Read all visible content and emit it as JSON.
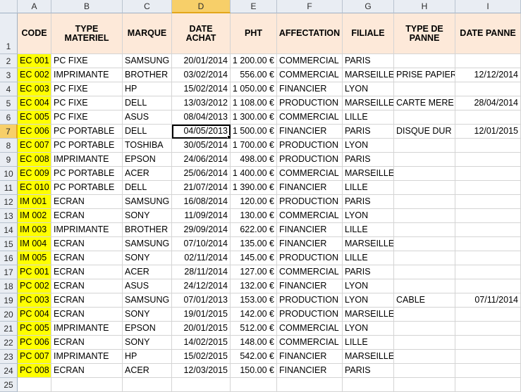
{
  "columns": [
    "A",
    "B",
    "C",
    "D",
    "E",
    "F",
    "G",
    "H",
    "I"
  ],
  "headers": [
    "CODE",
    "TYPE MATERIEL",
    "MARQUE",
    "DATE ACHAT",
    "PHT",
    "AFFECTATION",
    "FILIALE",
    "TYPE DE PANNE",
    "DATE PANNE"
  ],
  "row_numbers": [
    "1",
    "2",
    "3",
    "4",
    "5",
    "6",
    "7",
    "8",
    "9",
    "10",
    "11",
    "12",
    "13",
    "14",
    "15",
    "16",
    "17",
    "18",
    "19",
    "20",
    "21",
    "22",
    "23",
    "24",
    "25"
  ],
  "rows": [
    [
      "EC 001",
      "PC FIXE",
      "SAMSUNG",
      "20/01/2014",
      "1 200.00 €",
      "COMMERCIAL",
      "PARIS",
      "",
      ""
    ],
    [
      "EC 002",
      "IMPRIMANTE",
      "BROTHER",
      "03/02/2014",
      "556.00 €",
      "COMMERCIAL",
      "MARSEILLE",
      "PRISE PAPIER",
      "12/12/2014"
    ],
    [
      "EC 003",
      "PC FIXE",
      "HP",
      "15/02/2014",
      "1 050.00 €",
      "FINANCIER",
      "LYON",
      "",
      ""
    ],
    [
      "EC 004",
      "PC FIXE",
      "DELL",
      "13/03/2012",
      "1 108.00 €",
      "PRODUCTION",
      "MARSEILLE",
      "CARTE MERE",
      "28/04/2014"
    ],
    [
      "EC 005",
      "PC FIXE",
      "ASUS",
      "08/04/2013",
      "1 300.00 €",
      "COMMERCIAL",
      "LILLE",
      "",
      ""
    ],
    [
      "EC 006",
      "PC PORTABLE",
      "DELL",
      "04/05/2013",
      "1 500.00 €",
      "FINANCIER",
      "PARIS",
      "DISQUE DUR",
      "12/01/2015"
    ],
    [
      "EC 007",
      "PC PORTABLE",
      "TOSHIBA",
      "30/05/2014",
      "1 700.00 €",
      "PRODUCTION",
      "LYON",
      "",
      ""
    ],
    [
      "EC 008",
      "IMPRIMANTE",
      "EPSON",
      "24/06/2014",
      "498.00 €",
      "PRODUCTION",
      "PARIS",
      "",
      ""
    ],
    [
      "EC 009",
      "PC PORTABLE",
      "ACER",
      "25/06/2014",
      "1 400.00 €",
      "COMMERCIAL",
      "MARSEILLE",
      "",
      ""
    ],
    [
      "EC 010",
      "PC PORTABLE",
      "DELL",
      "21/07/2014",
      "1 390.00 €",
      "FINANCIER",
      "LILLE",
      "",
      ""
    ],
    [
      "IM 001",
      "ECRAN",
      "SAMSUNG",
      "16/08/2014",
      "120.00 €",
      "PRODUCTION",
      "PARIS",
      "",
      ""
    ],
    [
      "IM 002",
      "ECRAN",
      "SONY",
      "11/09/2014",
      "130.00 €",
      "COMMERCIAL",
      "LYON",
      "",
      ""
    ],
    [
      "IM 003",
      "IMPRIMANTE",
      "BROTHER",
      "29/09/2014",
      "622.00 €",
      "FINANCIER",
      "LILLE",
      "",
      ""
    ],
    [
      "IM 004",
      "ECRAN",
      "SAMSUNG",
      "07/10/2014",
      "135.00 €",
      "FINANCIER",
      "MARSEILLE",
      "",
      ""
    ],
    [
      "IM 005",
      "ECRAN",
      "SONY",
      "02/11/2014",
      "145.00 €",
      "PRODUCTION",
      "LILLE",
      "",
      ""
    ],
    [
      "PC 001",
      "ECRAN",
      "ACER",
      "28/11/2014",
      "127.00 €",
      "COMMERCIAL",
      "PARIS",
      "",
      ""
    ],
    [
      "PC 002",
      "ECRAN",
      "ASUS",
      "24/12/2014",
      "132.00 €",
      "FINANCIER",
      "LYON",
      "",
      ""
    ],
    [
      "PC 003",
      "ECRAN",
      "SAMSUNG",
      "07/01/2013",
      "153.00 €",
      "PRODUCTION",
      "LYON",
      "CABLE",
      "07/11/2014"
    ],
    [
      "PC 004",
      "ECRAN",
      "SONY",
      "19/01/2015",
      "142.00 €",
      "PRODUCTION",
      "MARSEILLE",
      "",
      ""
    ],
    [
      "PC 005",
      "IMPRIMANTE",
      "EPSON",
      "20/01/2015",
      "512.00 €",
      "COMMERCIAL",
      "LYON",
      "",
      ""
    ],
    [
      "PC 006",
      "ECRAN",
      "SONY",
      "14/02/2015",
      "148.00 €",
      "COMMERCIAL",
      "LILLE",
      "",
      ""
    ],
    [
      "PC 007",
      "IMPRIMANTE",
      "HP",
      "15/02/2015",
      "542.00 €",
      "FINANCIER",
      "MARSEILLE",
      "",
      ""
    ],
    [
      "PC 008",
      "ECRAN",
      "ACER",
      "12/03/2015",
      "150.00 €",
      "FINANCIER",
      "PARIS",
      "",
      ""
    ],
    [
      "",
      "",
      "",
      "",
      "",
      "",
      "",
      "",
      ""
    ]
  ],
  "active_cell": {
    "column": "D",
    "row": "7"
  },
  "colors": {
    "code_fill": "#ffff00",
    "header_fill": "#fde9d9",
    "active_header": "#f7cf69"
  }
}
